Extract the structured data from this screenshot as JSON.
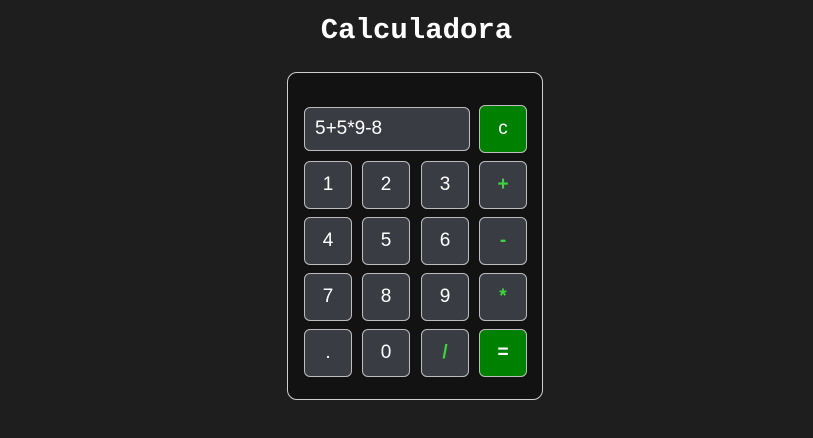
{
  "page": {
    "title": "Calculadora"
  },
  "display": {
    "value": "5+5*9-8"
  },
  "keys": {
    "clear": "c",
    "one": "1",
    "two": "2",
    "three": "3",
    "plus": "+",
    "four": "4",
    "five": "5",
    "six": "6",
    "minus": "-",
    "seven": "7",
    "eight": "8",
    "nine": "9",
    "multiply": "*",
    "dot": ".",
    "zero": "0",
    "divide": "/",
    "equals": "="
  },
  "colors": {
    "background": "#1e1e1e",
    "panel": "#121212",
    "key": "#3a3c44",
    "accent_green": "#008000",
    "operator_text": "#3bd63b"
  }
}
